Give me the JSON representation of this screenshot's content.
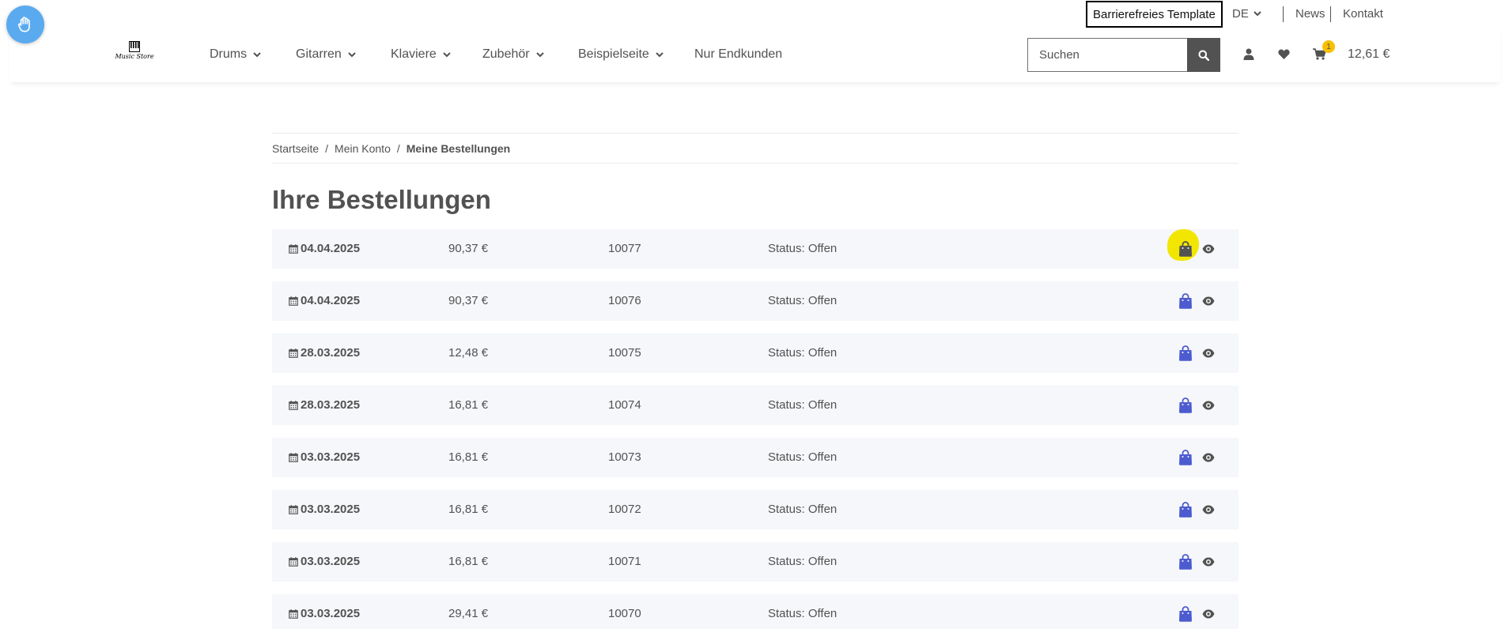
{
  "header": {
    "accessibility_button": "accessibility-hand-icon",
    "barrierefrei_label": "Barrierefreies Template",
    "language": "DE",
    "links": [
      "News",
      "Kontakt"
    ],
    "logo_text": "Music Store",
    "nav": [
      "Drums",
      "Gitarren",
      "Klaviere",
      "Zubehör",
      "Beispielseite",
      "Nur Endkunden"
    ],
    "search_placeholder": "Suchen",
    "cart_count": "1",
    "cart_total": "12,61 €"
  },
  "breadcrumb": [
    "Startseite",
    "Mein Konto",
    "Meine Bestellungen"
  ],
  "page_title": "Ihre Bestellungen",
  "orders": [
    {
      "date": "04.04.2025",
      "amount": "90,37 €",
      "number": "10077",
      "status": "Status: Offen"
    },
    {
      "date": "04.04.2025",
      "amount": "90,37 €",
      "number": "10076",
      "status": "Status: Offen"
    },
    {
      "date": "28.03.2025",
      "amount": "12,48 €",
      "number": "10075",
      "status": "Status: Offen"
    },
    {
      "date": "28.03.2025",
      "amount": "16,81 €",
      "number": "10074",
      "status": "Status: Offen"
    },
    {
      "date": "03.03.2025",
      "amount": "16,81 €",
      "number": "10073",
      "status": "Status: Offen"
    },
    {
      "date": "03.03.2025",
      "amount": "16,81 €",
      "number": "10072",
      "status": "Status: Offen"
    },
    {
      "date": "03.03.2025",
      "amount": "16,81 €",
      "number": "10071",
      "status": "Status: Offen"
    },
    {
      "date": "03.03.2025",
      "amount": "29,41 €",
      "number": "10070",
      "status": "Status: Offen"
    }
  ],
  "colors": {
    "text": "#525252",
    "row_bg": "#f5f7fa",
    "bag_icon": "#4d5bd0",
    "highlight": "#f2e600",
    "badge": "#f8bf00",
    "a11y_button": "#5aaaf0"
  }
}
